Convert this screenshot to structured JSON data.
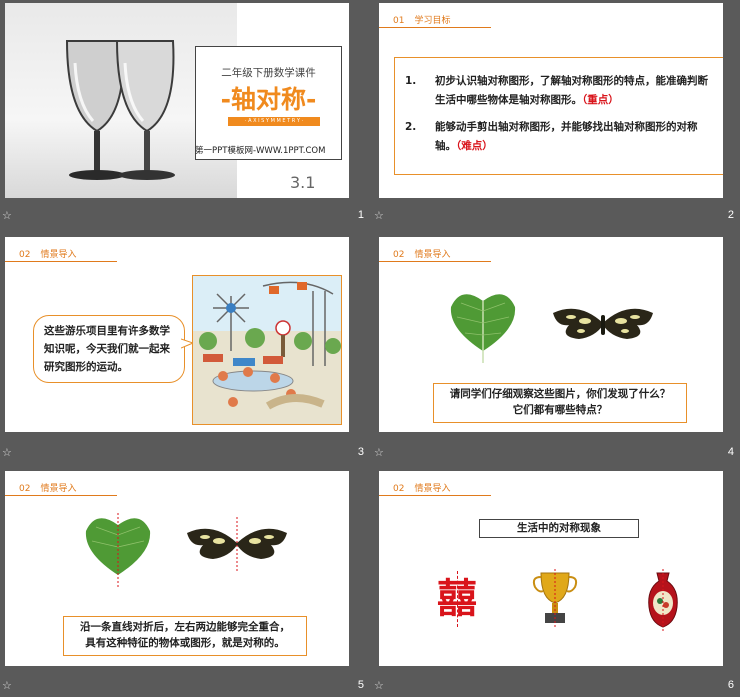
{
  "slides": [
    {
      "number": "1",
      "subtitle": "二年级下册数学课件",
      "title": "-轴对称-",
      "en": "· A X I S Y M M E T R Y ·",
      "site": "第一PPT模板网-WWW.1PPT.COM",
      "section": "3.1"
    },
    {
      "number": "2",
      "hdr_num": "01",
      "hdr_title": "学习目标",
      "items": [
        {
          "idx": "1.",
          "text": "初步认识轴对称图形，了解轴对称图形的特点，能准确判断生活中哪些物体是轴对称图形。",
          "tag": "（重点）"
        },
        {
          "idx": "2.",
          "text": "能够动手剪出轴对称图形，并能够找出轴对称图形的对称轴。",
          "tag": "（难点）"
        }
      ]
    },
    {
      "number": "3",
      "hdr_num": "02",
      "hdr_title": "情景导入",
      "bubble": "这些游乐项目里有许多数学知识呢，今天我们就一起来研究图形的运动。"
    },
    {
      "number": "4",
      "hdr_num": "02",
      "hdr_title": "情景导入",
      "question_line1": "请同学们仔细观察这些图片，你们发现了什么？",
      "question_line2": "它们都有哪些特点？"
    },
    {
      "number": "5",
      "hdr_num": "02",
      "hdr_title": "情景导入",
      "caption_line1": "沿一条直线对折后，左右两边能够完全重合，",
      "caption_line2": "具有这种特征的物体或图形，就是对称的。"
    },
    {
      "number": "6",
      "hdr_num": "02",
      "hdr_title": "情景导入",
      "box_title": "生活中的对称现象",
      "xi": "囍"
    }
  ],
  "icons": {
    "star": "☆"
  },
  "colors": {
    "accent": "#e07a1c",
    "red": "#d9141b",
    "bar": "#5a5a5a"
  }
}
